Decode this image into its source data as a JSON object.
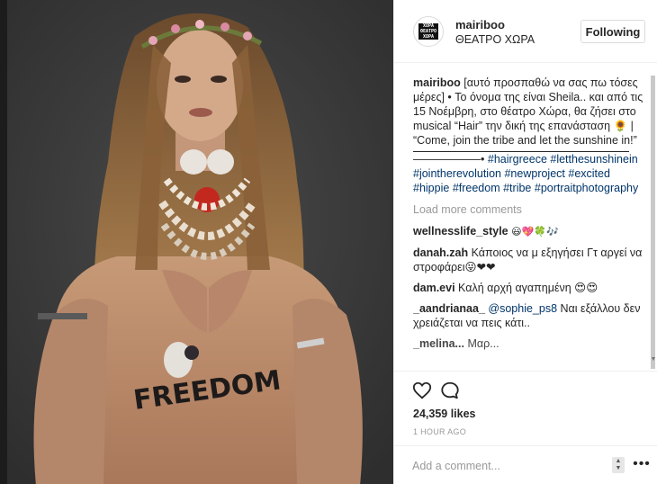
{
  "post": {
    "username": "mairiboo",
    "location": "ΘΕΑΤΡΟ ΧΩΡΑ",
    "follow_label": "Following",
    "avatar_logo_lines": [
      "ΧΩΡΑ",
      "ΘΕΑΤΡΟ",
      "ΧΩΡΑ"
    ],
    "photo_text": "FREEDOM"
  },
  "caption": {
    "username": "mairiboo",
    "text": "[αυτό προσπαθώ να σας πω τόσες μέρες] • Το όνομα της είναι Sheila.. και από τις 15 Νοέμβρη, στο θέατρο Χώρα, θα ζήσει στο musical “Hair” την δική της επανάσταση 🌻 | “Come, join the tribe and let the sunshine in!”",
    "divider": "——————•",
    "hashtags": [
      "#hairgreece",
      "#letthesunshinein",
      "#jointherevolution",
      "#newproject",
      "#excited",
      "#hippie",
      "#freedom",
      "#tribe",
      "#portraitphotography"
    ]
  },
  "load_more_label": "Load more comments",
  "comments": [
    {
      "user": "wellnesslife_style",
      "mention": "",
      "text": "😃💖🍀🎶"
    },
    {
      "user": "danah.zah",
      "mention": "",
      "text": "Κάποιος να μ εξηγήσει Γτ αργεί να στροφάρει😜❤❤"
    },
    {
      "user": "dam.evi",
      "mention": "",
      "text": "Καλή αρχή αγαπημένη 😍😍"
    },
    {
      "user": "_aandrianaa_",
      "mention": "@sophie_ps8",
      "text": "Ναι εξάλλου δεν χρειάζεται να πεις κάτι.."
    },
    {
      "user": "_melina...",
      "mention": "",
      "text": "Μαρ..."
    }
  ],
  "likes": "24,359 likes",
  "timestamp": "1 HOUR AGO",
  "add_comment_placeholder": "Add a comment...",
  "more_label": "•••",
  "icons": [
    "heart-icon",
    "comment-icon",
    "more-options-icon",
    "scroll-down-icon"
  ],
  "colors": {
    "hashtag": "#003569",
    "muted": "#999999",
    "border": "#efefef"
  }
}
